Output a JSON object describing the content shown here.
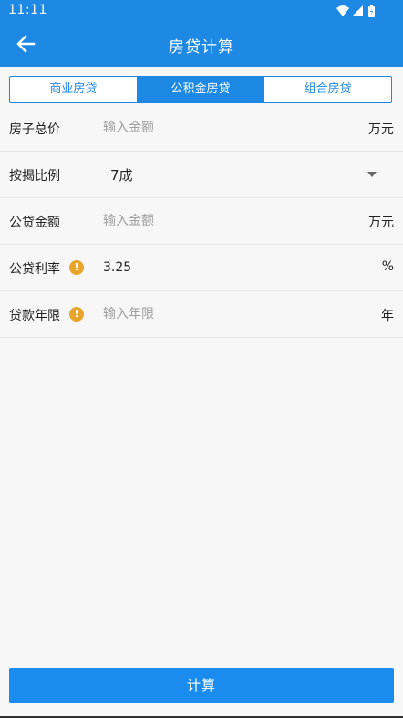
{
  "status_bar": {
    "time": "11:11"
  },
  "app_bar": {
    "title": "房贷计算"
  },
  "tabs": [
    {
      "label": "商业房贷"
    },
    {
      "label": "公积金房贷",
      "active": true
    },
    {
      "label": "组合房贷"
    }
  ],
  "form": {
    "total_price": {
      "label": "房子总价",
      "placeholder": "输入金额",
      "unit": "万元"
    },
    "down_payment": {
      "label": "按揭比例",
      "value": "7成"
    },
    "loan_amount": {
      "label": "公贷金额",
      "placeholder": "输入金额",
      "unit": "万元"
    },
    "interest_rate": {
      "label": "公贷利率",
      "value": "3.25",
      "unit": "%"
    },
    "loan_term": {
      "label": "贷款年限",
      "placeholder": "输入年限",
      "unit": "年"
    }
  },
  "calculate_button": {
    "label": "计算"
  },
  "colors": {
    "primary": "#1e88e5",
    "warning": "#e8a52a"
  },
  "icons": [
    "back-arrow-icon",
    "wifi-icon",
    "signal-icon",
    "battery-icon",
    "warning-icon",
    "dropdown-arrow-icon"
  ]
}
